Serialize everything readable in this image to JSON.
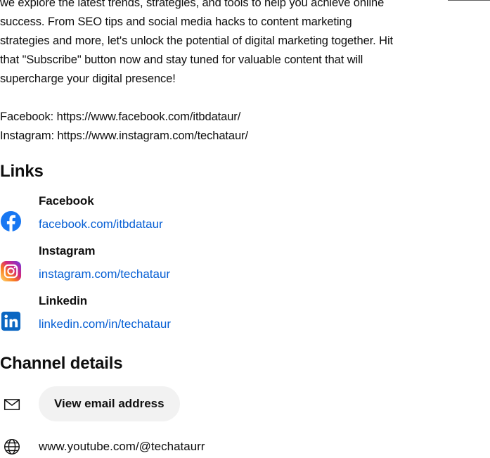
{
  "description": {
    "lines": [
      "we explore the latest trends, strategies, and tools to help you achieve online",
      "success. From SEO tips and social media hacks to content marketing",
      "strategies and more, let's unlock the potential of digital marketing together. Hit",
      "that \"Subscribe\" button now and stay tuned for valuable content that will",
      "supercharge your digital presence!",
      "Facebook: https://www.facebook.com/itbdataur/",
      "Instagram: https://www.instagram.com/techataur/"
    ]
  },
  "links_section": {
    "title": "Links",
    "items": [
      {
        "name": "Facebook",
        "url": "facebook.com/itbdataur",
        "icon": "facebook-icon",
        "color": "#1877f2"
      },
      {
        "name": "Instagram",
        "url": "instagram.com/techataur",
        "icon": "instagram-icon",
        "color": "#e1306c"
      },
      {
        "name": "Linkedin",
        "url": "linkedin.com/in/techataur",
        "icon": "linkedin-icon",
        "color": "#0a66c2"
      }
    ]
  },
  "channel_details": {
    "title": "Channel details",
    "email_button": "View email address",
    "channel_url": "www.youtube.com/@techataurr"
  },
  "colors": {
    "link_blue": "#065fd4",
    "text": "#0f0f0f",
    "button_bg": "#f2f2f2"
  }
}
